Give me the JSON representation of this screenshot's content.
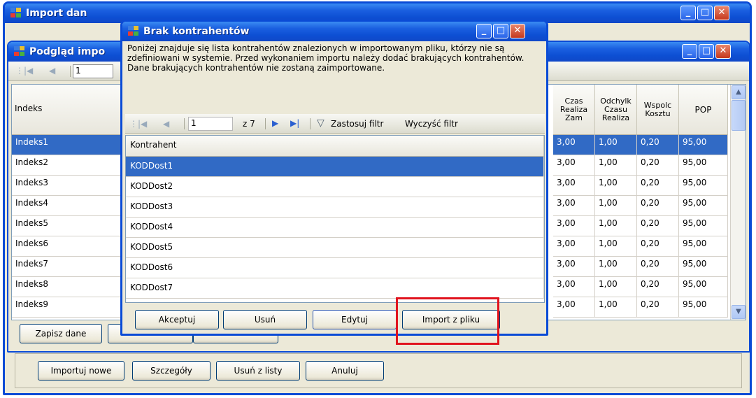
{
  "colors": {
    "title_blue": "#0d4fd3",
    "selection": "#316ac5",
    "highlight_red": "#e1141e",
    "window_bg": "#ece9d8"
  },
  "back_window": {
    "title": "Import dan"
  },
  "mid_window": {
    "title": "Podgląd impo",
    "pager_value": "1",
    "columns": [
      "Indeks",
      "Czas Realiza Zam",
      "Odchylk Czasu Realiza",
      "Wspolc Kosztu",
      "POP"
    ],
    "rows": [
      [
        "Indeks1",
        "3,00",
        "1,00",
        "0,20",
        "95,00"
      ],
      [
        "Indeks2",
        "3,00",
        "1,00",
        "0,20",
        "95,00"
      ],
      [
        "Indeks3",
        "3,00",
        "1,00",
        "0,20",
        "95,00"
      ],
      [
        "Indeks4",
        "3,00",
        "1,00",
        "0,20",
        "95,00"
      ],
      [
        "Indeks5",
        "3,00",
        "1,00",
        "0,20",
        "95,00"
      ],
      [
        "Indeks6",
        "3,00",
        "1,00",
        "0,20",
        "95,00"
      ],
      [
        "Indeks7",
        "3,00",
        "1,00",
        "0,20",
        "95,00"
      ],
      [
        "Indeks8",
        "3,00",
        "1,00",
        "0,20",
        "95,00"
      ],
      [
        "Indeks9",
        "3,00",
        "1,00",
        "0,20",
        "95,00"
      ]
    ],
    "save_button": "Zapisz dane"
  },
  "bottom_buttons": {
    "import_new": "Importuj nowe",
    "details": "Szczegóły",
    "remove": "Usuń z listy",
    "cancel": "Anuluj"
  },
  "dialog": {
    "title": "Brak kontrahentów",
    "message": "Poniżej znajduje się lista kontrahentów znalezionych w importowanym pliku, którzy nie są zdefiniowani w systemie. Przed wykonaniem importu należy dodać brakujących kontrahentów. Dane brakujących kontrahentów nie zostaną zaimportowane.",
    "pager": {
      "current": "1",
      "of_total": "z 7",
      "apply_filter": "Zastosuj filtr",
      "clear_filter": "Wyczyść filtr"
    },
    "column": "Kontrahent",
    "rows": [
      "KODDost1",
      "KODDost2",
      "KODDost3",
      "KODDost4",
      "KODDost5",
      "KODDost6",
      "KODDost7"
    ],
    "buttons": {
      "accept": "Akceptuj",
      "delete": "Usuń",
      "edit": "Edytuj",
      "import_file": "Import z pliku"
    }
  }
}
